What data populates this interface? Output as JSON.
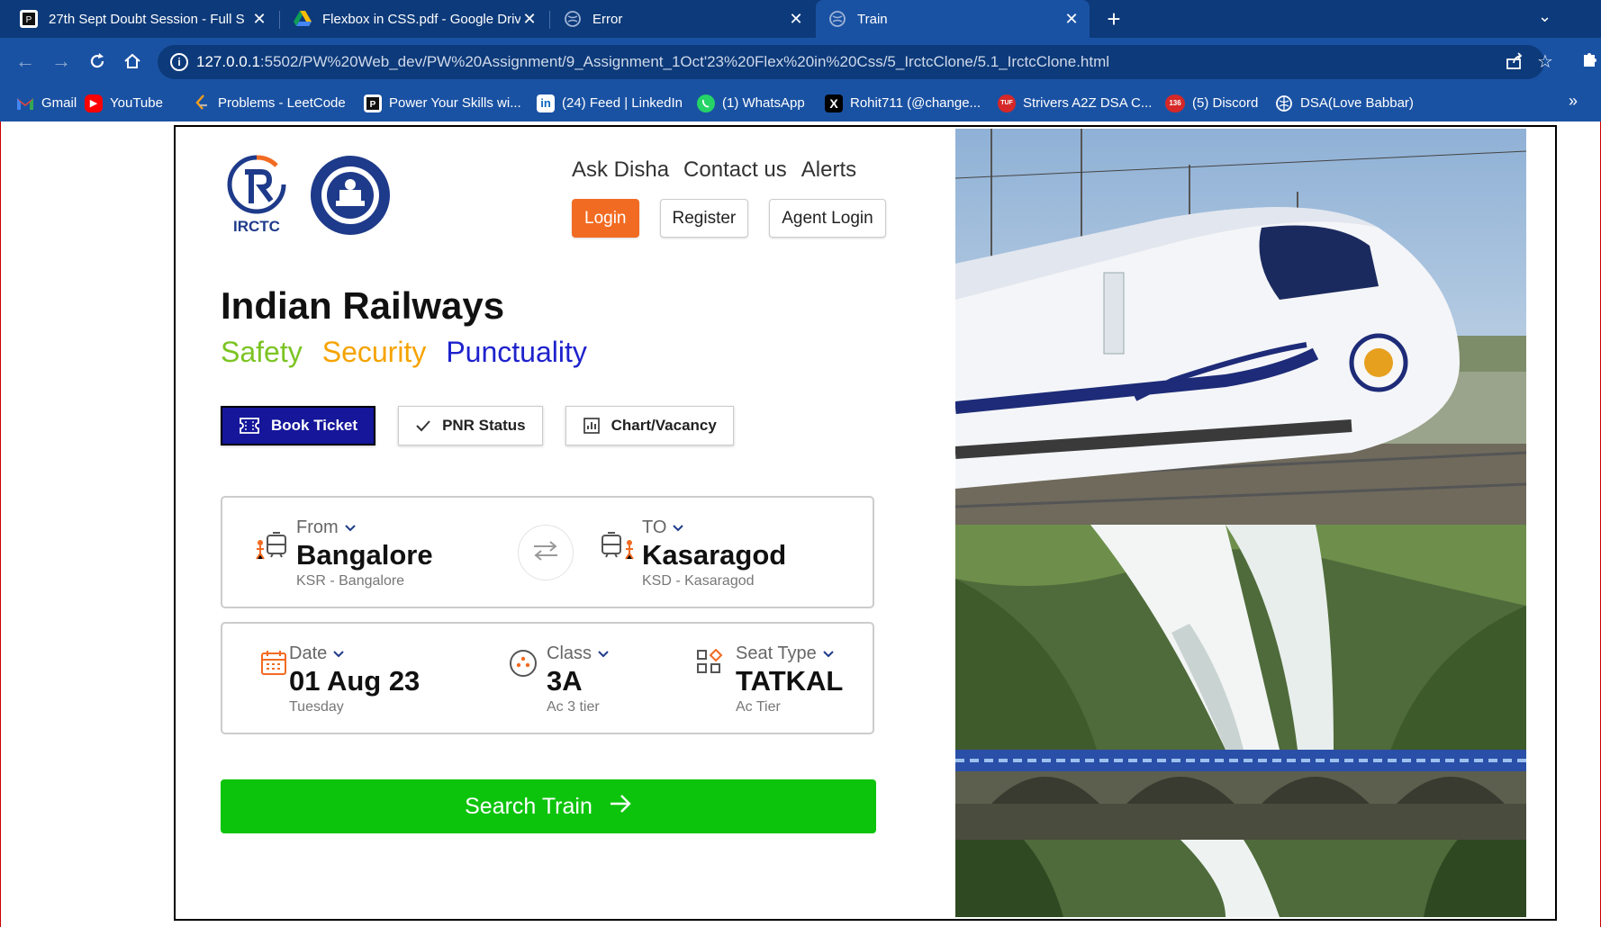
{
  "browser": {
    "tabs": [
      {
        "title": "27th Sept Doubt Session - Full S",
        "icon": "youtube-like-icon"
      },
      {
        "title": "Flexbox in CSS.pdf - Google Driv",
        "icon": "google-drive-icon"
      },
      {
        "title": "Error",
        "icon": "globe-icon"
      },
      {
        "title": "Train",
        "icon": "globe-icon"
      }
    ],
    "url_host": "127.0.0.1",
    "url_rest": ":5502/PW%20Web_dev/PW%20Assignment/9_Assignment_1Oct'23%20Flex%20in%20Css/5_IrctcClone/5.1_IrctcClone.html",
    "bookmarks": [
      {
        "label": "Gmail",
        "icon": "gmail-icon",
        "color": "#ea4335"
      },
      {
        "label": "YouTube",
        "icon": "youtube-icon",
        "color": "#ff0000"
      },
      {
        "label": "Problems - LeetCode",
        "icon": "leetcode-icon",
        "color": "#f89f1b"
      },
      {
        "label": "Power Your Skills wi...",
        "icon": "pw-icon",
        "color": "#222222"
      },
      {
        "label": "(24) Feed | LinkedIn",
        "icon": "linkedin-icon",
        "color": "#0a66c2"
      },
      {
        "label": "(1) WhatsApp",
        "icon": "whatsapp-icon",
        "color": "#25d366"
      },
      {
        "label": "Rohit711 (@change...",
        "icon": "x-icon",
        "color": "#000000"
      },
      {
        "label": "Strivers A2Z DSA C...",
        "icon": "tuf-icon",
        "color": "#d62828"
      },
      {
        "label": "(5) Discord",
        "icon": "discord-icon",
        "color": "#d62828"
      },
      {
        "label": "DSA(Love Babbar)",
        "icon": "globe-icon",
        "color": "#ffffff"
      }
    ],
    "discord_badge": "136"
  },
  "header": {
    "logo_text": "IRCTC",
    "links": [
      "Ask Disha",
      "Contact us",
      "Alerts"
    ],
    "buttons": {
      "login": "Login",
      "register": "Register",
      "agent": "Agent Login"
    }
  },
  "hero": {
    "title": "Indian Railways",
    "taglines": [
      "Safety",
      "Security",
      "Punctuality"
    ]
  },
  "modes": [
    {
      "label": "Book Ticket",
      "icon": "ticket-icon",
      "active": true
    },
    {
      "label": "PNR Status",
      "icon": "check-icon",
      "active": false
    },
    {
      "label": "Chart/Vacancy",
      "icon": "chart-icon",
      "active": false
    }
  ],
  "journey": {
    "from": {
      "label": "From",
      "value": "Bangalore",
      "sub": "KSR - Bangalore"
    },
    "to": {
      "label": "TO",
      "value": "Kasaragod",
      "sub": "KSD - Kasaragod"
    },
    "date": {
      "label": "Date",
      "value": "01 Aug 23",
      "sub": "Tuesday"
    },
    "class": {
      "label": "Class",
      "value": "3A",
      "sub": "Ac 3 tier"
    },
    "seat": {
      "label": "Seat Type",
      "value": "TATKAL",
      "sub": "Ac Tier"
    }
  },
  "search": {
    "label": "Search Train"
  },
  "colors": {
    "login": "#f26b22",
    "search": "#0dc40d",
    "book_active": "#15169a",
    "safety": "#7cc423",
    "security": "#f5a300",
    "punctuality": "#1e22cc"
  }
}
